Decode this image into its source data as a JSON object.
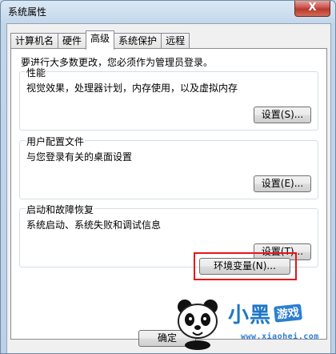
{
  "window": {
    "title": "系统属性",
    "close_label": "X"
  },
  "tabs": [
    {
      "label": "计算机名"
    },
    {
      "label": "硬件"
    },
    {
      "label": "高级"
    },
    {
      "label": "系统保护"
    },
    {
      "label": "远程"
    }
  ],
  "active_tab": "高级",
  "notice": "要进行大多数更改，您必须作为管理员登录。",
  "groups": {
    "performance": {
      "legend": "性能",
      "desc": "视觉效果，处理器计划，内存使用，以及虚拟内存",
      "button": "设置(S)..."
    },
    "profiles": {
      "legend": "用户配置文件",
      "desc": "与您登录有关的桌面设置",
      "button": "设置(E)..."
    },
    "startup": {
      "legend": "启动和故障恢复",
      "desc": "系统启动、系统失败和调试信息",
      "button": "设置(T)..."
    }
  },
  "env_button": "环境变量(N)...",
  "ok_button": "确定",
  "watermark": {
    "brand": "小黑",
    "tag": "游戏",
    "url": "www.xiaohei.com"
  },
  "colors": {
    "highlight": "#e8141a",
    "watermark": "#1d76c8"
  }
}
